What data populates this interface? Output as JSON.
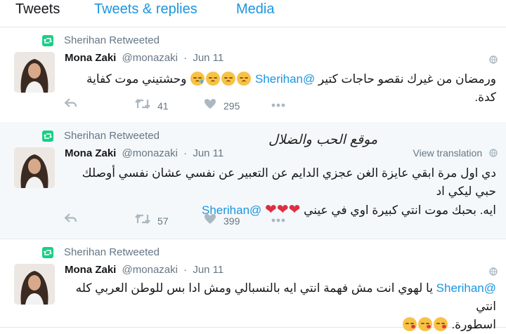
{
  "tabs": [
    "Tweets",
    "Tweets & replies",
    "Media"
  ],
  "colors": {
    "link": "#1b95e0",
    "retweet": "#19cf86",
    "muted": "#657786",
    "heart": "#dd2e44",
    "highlight_bg": "#f5f8fa"
  },
  "tweets": [
    {
      "retweet_label": "Sherihan Retweeted",
      "name": "Mona Zaki",
      "handle": "@monazaki",
      "separator": "·",
      "date": "Jun 11",
      "lines": [
        {
          "text": "ورمضان من غيرك نقصو حاجات كتير",
          "mention": "@Sherihan",
          "tail": "وحشتيني موت كفاية كدة."
        }
      ],
      "emoji": [
        "disappointed-face",
        "disappointed-face",
        "disappointed-face",
        "crying-face"
      ],
      "retweets": "41",
      "likes": "295"
    },
    {
      "retweet_label": "Sherihan Retweeted",
      "name": "Mona Zaki",
      "handle": "@monazaki",
      "separator": "·",
      "date": "Jun 11",
      "view_translation": "View translation",
      "watermark": "موقع الحب والضلال",
      "lines": [
        {
          "text": "دي اول مرة ابقي عايزة الغن عجزي الدايم عن التعبير عن نفسي عشان نفسي أوصلك حبي ليكي اد"
        },
        {
          "text": "ايه. بحبك موت انتي كبيرة اوي في عيني",
          "mention": "@Sherihan"
        }
      ],
      "emoji": [
        "red-heart",
        "red-heart",
        "red-heart"
      ],
      "retweets": "57",
      "likes": "399"
    },
    {
      "retweet_label": "Sherihan Retweeted",
      "name": "Mona Zaki",
      "handle": "@monazaki",
      "separator": "·",
      "date": "Jun 11",
      "lines": [
        {
          "mention": "@Sherihan",
          "text": "يا لهوي انت مش فهمة انتي ايه بالنسبالي ومش ادا بس للوطن العربي كله انتي"
        },
        {
          "text": "اسطورة."
        }
      ],
      "emoji": [
        "kissing-face",
        "kissing-face",
        "kissing-face"
      ]
    }
  ]
}
